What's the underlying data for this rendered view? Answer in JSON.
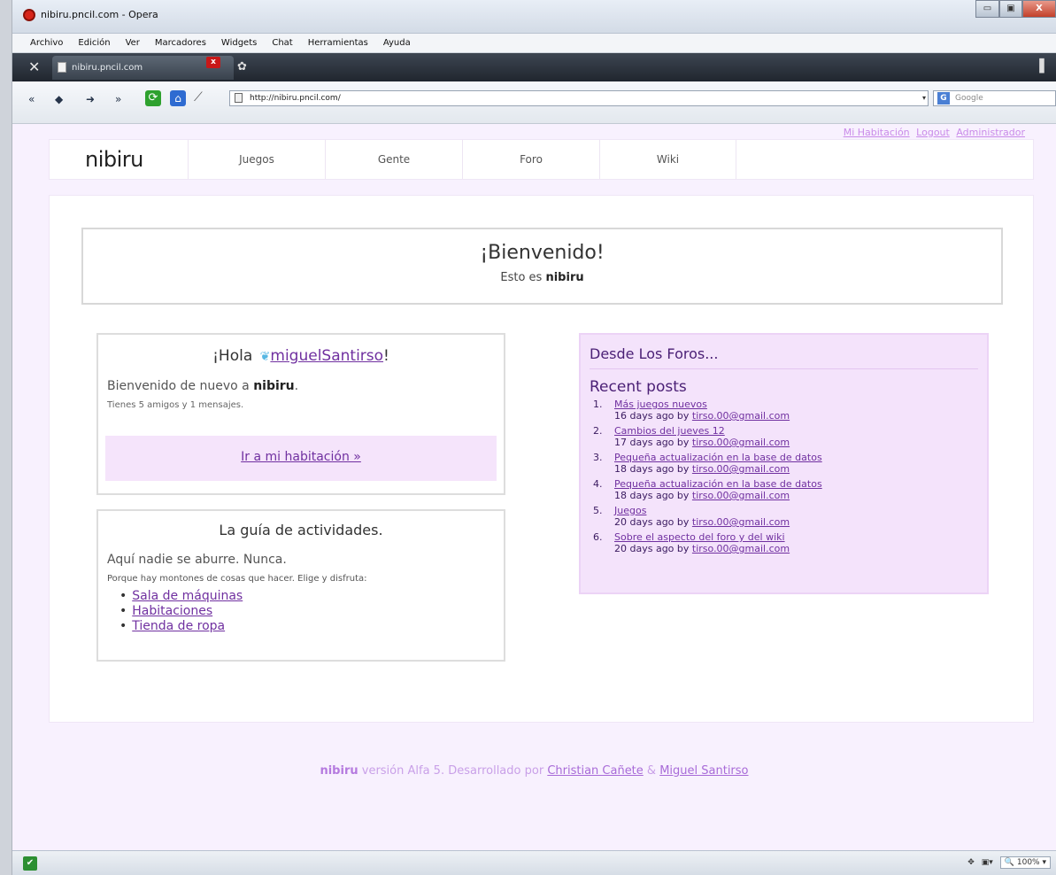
{
  "window": {
    "title": "nibiru.pncil.com - Opera",
    "min": "▭",
    "max": "▣",
    "close": "X"
  },
  "menu": [
    "Archivo",
    "Edición",
    "Ver",
    "Marcadores",
    "Widgets",
    "Chat",
    "Herramientas",
    "Ayuda"
  ],
  "tab": {
    "label": "nibiru.pncil.com",
    "close": "x",
    "new_tab": "✿",
    "end": "▌"
  },
  "nav_buttons": [
    "«",
    "◆",
    "➜",
    "»"
  ],
  "address": {
    "url": "http://nibiru.pncil.com/",
    "search_placeholder": "Google",
    "reload": "⟳",
    "home": "⌂",
    "wand": "⟋",
    "search_g": "G",
    "drop": "▾"
  },
  "page": {
    "top_links": [
      "Mi Habitación",
      "Logout",
      "Administrador"
    ],
    "logo": "nibiru",
    "nav": [
      "Juegos",
      "Gente",
      "Foro",
      "Wiki"
    ],
    "welcome": {
      "title": "¡Bienvenido!",
      "sub_prefix": "Esto es",
      "sub_brand": "nibiru"
    },
    "hola": {
      "greeting": "¡Hola",
      "user": "miguelSantirso",
      "bang": "!",
      "bird": "❦",
      "back_prefix": "Bienvenido de nuevo a",
      "back_brand": "nibiru",
      "back_suffix": ".",
      "friends": "Tienes 5 amigos y 1 mensajes.",
      "room_link": "Ir a mi habitación »"
    },
    "guia": {
      "title": "La guía de actividades.",
      "line1": "Aquí nadie se aburre. Nunca.",
      "line2": "Porque hay montones de cosas que hacer. Elige y disfruta:",
      "items": [
        "Sala de máquinas",
        "Habitaciones",
        "Tienda de ropa"
      ]
    },
    "foros": {
      "title": "Desde Los Foros...",
      "subtitle": "Recent posts",
      "posts": [
        {
          "num": "1.",
          "title": "Más juegos nuevos",
          "meta": "16 days ago by",
          "author": "tirso.00@gmail.com"
        },
        {
          "num": "2.",
          "title": "Cambios del jueves 12",
          "meta": "17 days ago by",
          "author": "tirso.00@gmail.com"
        },
        {
          "num": "3.",
          "title": "Pequeña actualización en la base de datos",
          "meta": "18 days ago by",
          "author": "tirso.00@gmail.com"
        },
        {
          "num": "4.",
          "title": "Pequeña actualización en la base de datos",
          "meta": "18 days ago by",
          "author": "tirso.00@gmail.com"
        },
        {
          "num": "5.",
          "title": "Juegos",
          "meta": "20 days ago by",
          "author": "tirso.00@gmail.com"
        },
        {
          "num": "6.",
          "title": "Sobre el aspecto del foro y del wiki",
          "meta": "20 days ago by",
          "author": "tirso.00@gmail.com"
        }
      ]
    },
    "footer": {
      "brand": "nibiru",
      "text": "versión Alfa 5. Desarrollado por",
      "author1": "Christian Cañete",
      "amp": "&",
      "author2": "Miguel Santirso"
    }
  },
  "status": {
    "zoom": "100%",
    "left_icon": "✔",
    "right_icons": [
      "✥",
      "▣▾"
    ]
  }
}
